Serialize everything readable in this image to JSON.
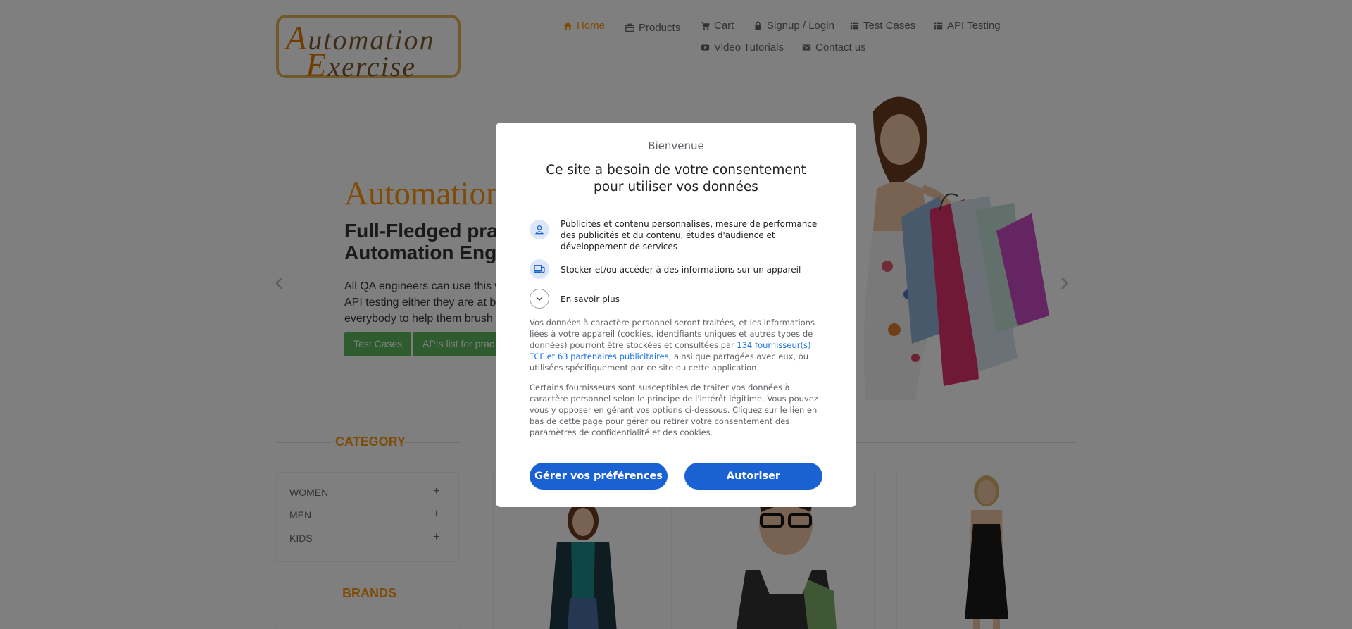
{
  "header": {
    "logo_line1": "Automation",
    "logo_line2": "Exercise",
    "nav": {
      "home": "Home",
      "products": "Products",
      "cart": "Cart",
      "signup": "Signup / Login",
      "test_cases": "Test Cases",
      "api_testing": "API Testing",
      "video_tutorials": "Video Tutorials",
      "contact": "Contact us"
    }
  },
  "hero": {
    "title": "Automation",
    "subtitle_line1": "Full-Fledged prac",
    "subtitle_line2": "Automation Engi",
    "text_line1": "All QA engineers can use this w",
    "text_line2": "API testing either they are at b",
    "text_line3": "everybody to help them brush",
    "btn_test_cases": "Test Cases",
    "btn_apis": "APIs list for prac"
  },
  "sidebar": {
    "category_title": "CATEGORY",
    "categories": [
      "WOMEN",
      "MEN",
      "KIDS"
    ],
    "plus": "+",
    "brands_title": "BRANDS"
  },
  "consent": {
    "welcome": "Bienvenue",
    "title": "Ce site a besoin de votre consentement pour utiliser vos données",
    "purpose1": "Publicités et contenu personnalisés, mesure de performance des publicités et du contenu, études d'audience et développement de services",
    "purpose2": "Stocker et/ou accéder à des informations sur un appareil",
    "learn_more": "En savoir plus",
    "body1_a": "Vos données à caractère personnel seront traitées, et les informations liées à votre appareil (cookies, identifiants uniques et autres types de données) pourront être stockées et consultées par ",
    "body1_link": "134 fournisseur(s) TCF et 63 partenaires publicitaires",
    "body1_b": ", ainsi que partagées avec eux, ou utilisées spécifiquement par ce site ou cette application.",
    "body2": "Certains fournisseurs sont susceptibles de traiter vos données à caractère personnel selon le principe de l'intérêt légitime. Vous pouvez vous y opposer en gérant vos options ci-dessous. Cliquez sur le lien en bas de cette page pour gérer ou retirer votre consentement des paramètres de confidentialité et des cookies.",
    "manage_btn": "Gérer vos préférences",
    "accept_btn": "Autoriser"
  },
  "colors": {
    "accent": "#fe980f",
    "consent_button": "#1a62d3",
    "link": "#1a73e8",
    "green_button": "#5cb85c"
  },
  "icons": [
    "home-icon",
    "products-icon",
    "cart-icon",
    "lock-icon",
    "list-icon",
    "youtube-icon",
    "envelope-icon",
    "person-icon",
    "device-icon",
    "chevron-down-icon"
  ]
}
